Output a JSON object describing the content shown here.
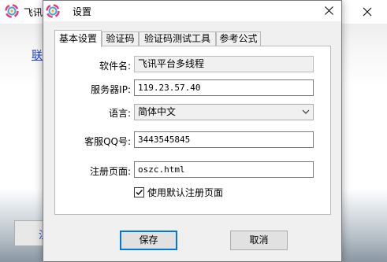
{
  "background_window": {
    "title": "飞讯平",
    "link_text": "联",
    "button_label": "注"
  },
  "dialog": {
    "title": "设置",
    "tabs": [
      {
        "label": "基本设置",
        "active": true
      },
      {
        "label": "验证码",
        "active": false
      },
      {
        "label": "验证码测试工具",
        "active": false
      },
      {
        "label": "参考公式",
        "active": false
      }
    ],
    "form": {
      "software_name": {
        "label": "软件名:",
        "value": "飞讯平台多线程"
      },
      "server_ip": {
        "label": "服务器IP:",
        "value": "119.23.57.40"
      },
      "language": {
        "label": "语言:",
        "value": "简体中文"
      },
      "support_qq": {
        "label": "客服QQ号:",
        "value": "3443545845"
      },
      "register_page": {
        "label": "注册页面:",
        "value": "oszc.html"
      },
      "use_default_register": {
        "label": "使用默认注册页面",
        "checked": true
      }
    },
    "buttons": {
      "save": "保存",
      "cancel": "取消"
    }
  },
  "colors": {
    "accent": "#0078d7",
    "link": "#1a3fd0",
    "dialog_bg": "#f0f0f0"
  }
}
